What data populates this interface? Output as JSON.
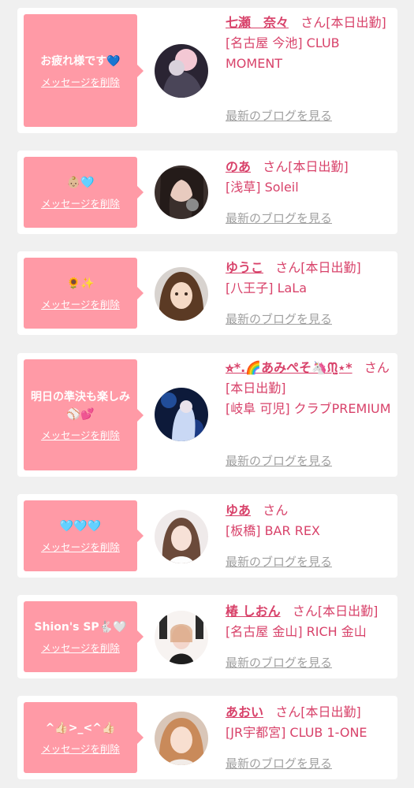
{
  "colors": {
    "accent": "#d8426a",
    "bubble": "#ff9aa6",
    "muted": "#a0a0a0",
    "card": "#ffffff",
    "background": "#f0f0f0"
  },
  "delete_label": "メッセージを削除",
  "blog_label": "最新のブログを見る",
  "honorific": "さん",
  "messages": [
    {
      "message": "お疲れ様です💙",
      "name": "七瀬　奈々",
      "status": "[本日出勤]",
      "shop": "[名古屋 今池] CLUB MOMENT"
    },
    {
      "message": "👶🏼🩵",
      "name": "のあ",
      "status": "[本日出勤]",
      "shop": "[浅草] Soleil"
    },
    {
      "message": "🌻✨",
      "name": "ゆうこ",
      "status": "[本日出勤]",
      "shop": "[八王子] LaLa"
    },
    {
      "message": "明日の準決も楽しみ⚾️💕",
      "name": "⭐︎*.🌈あみぺそ🦄ᙏ̤̫⋆*",
      "status": "[本日出勤]",
      "shop": "[岐阜 可児] クラブPREMIUM"
    },
    {
      "message": "🩵🩵🩵",
      "name": "ゆあ",
      "status": "",
      "shop": "[板橋] BAR REX"
    },
    {
      "message": "Shion's SP🐇🤍",
      "name": "椿 しおん",
      "status": "[本日出勤]",
      "shop": "[名古屋 金山] RICH 金山"
    },
    {
      "message": "^👍🏻>_<^👍🏻",
      "name": "あおい",
      "status": "[本日出勤]",
      "shop": "[JR宇都宮] CLUB 1-ONE"
    }
  ]
}
